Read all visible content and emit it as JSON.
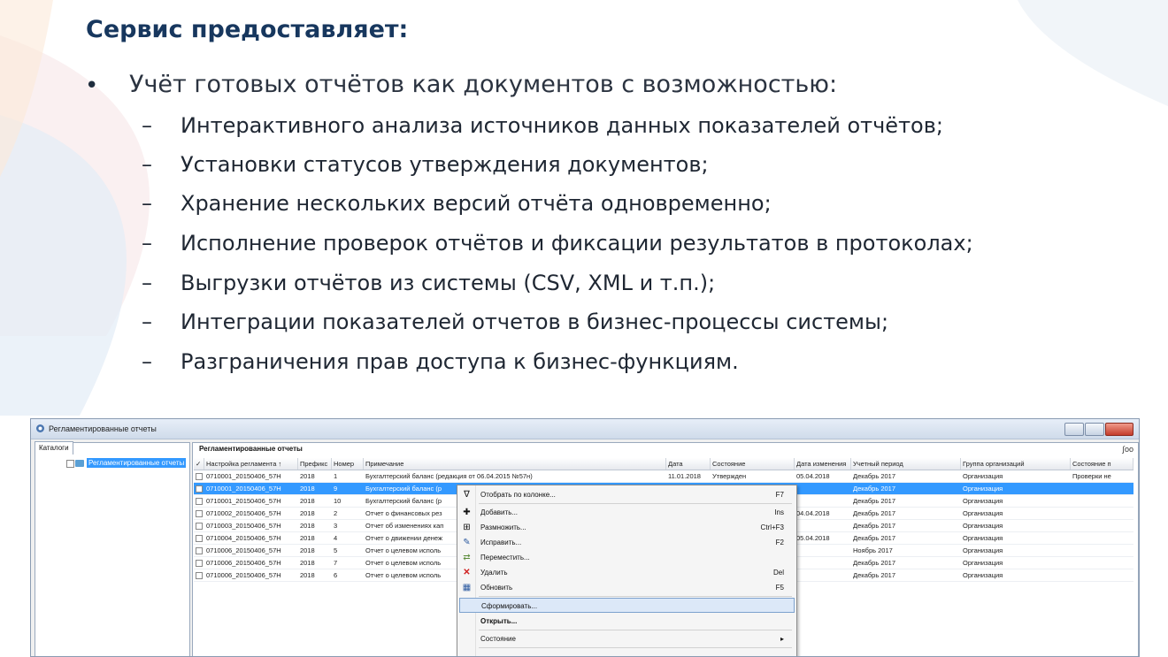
{
  "slide": {
    "title": "Сервис предоставляет:",
    "bullet": "Учёт готовых отчётов как документов с возможностью:",
    "items": [
      "Интерактивного анализа источников данных показателей отчётов;",
      "Установки статусов утверждения документов;",
      "Хранение нескольких версий отчёта одновременно;",
      "Исполнение проверок отчётов и фиксации результатов в протоколах;",
      "Выгрузки отчётов из системы (CSV, XML и т.п.);",
      "Интеграции показателей отчетов в бизнес-процессы системы;",
      "Разграничения прав доступа к бизнес-функциям."
    ],
    "dash": "–",
    "bullet_glyph": "•"
  },
  "window": {
    "title": "Регламентированные отчеты",
    "catalog_tab": "Каталоги",
    "tree_item": "Регламентированные отчеты",
    "grid_title": "Регламентированные отчеты",
    "filter_glyph": "∫oo",
    "columns": {
      "check": "✓",
      "setting": "Настройка регламента ↑",
      "prefix": "Префикс",
      "number": "Номер",
      "note": "Примечание",
      "date": "Дата",
      "state": "Состояние",
      "changed": "Дата изменения",
      "period": "Учетный период",
      "group": "Группа организаций",
      "check_state": "Состояние п"
    },
    "rows": [
      {
        "setting": "0710001_20150406_57Н",
        "prefix": "2018",
        "number": "1",
        "note": "Бухгалтерский баланс (редакция от 06.04.2015 №57н)",
        "date": "11.01.2018",
        "state": "Утвержден",
        "changed": "05.04.2018",
        "period": "Декабрь 2017",
        "group": "Организация",
        "check_state": "Проверки не"
      },
      {
        "setting": "0710001_20150406_57Н",
        "prefix": "2018",
        "number": "9",
        "note": "Бухгалтерский баланс (р",
        "date": "",
        "state": "",
        "changed": "",
        "period": "Декабрь 2017",
        "group": "Организация",
        "check_state": ""
      },
      {
        "setting": "0710001_20150406_57Н",
        "prefix": "2018",
        "number": "10",
        "note": "Бухгалтерский баланс (р",
        "date": "",
        "state": "",
        "changed": "",
        "period": "Декабрь 2017",
        "group": "Организация",
        "check_state": ""
      },
      {
        "setting": "0710002_20150406_57Н",
        "prefix": "2018",
        "number": "2",
        "note": "Отчет о финансовых рез",
        "date": "",
        "state": "",
        "changed": "04.04.2018",
        "period": "Декабрь 2017",
        "group": "Организация",
        "check_state": ""
      },
      {
        "setting": "0710003_20150406_57Н",
        "prefix": "2018",
        "number": "3",
        "note": "Отчет об изменениях кап",
        "date": "",
        "state": "",
        "changed": "",
        "period": "Декабрь 2017",
        "group": "Организация",
        "check_state": ""
      },
      {
        "setting": "0710004_20150406_57Н",
        "prefix": "2018",
        "number": "4",
        "note": "Отчет о движении денеж",
        "date": "",
        "state": "",
        "changed": "05.04.2018",
        "period": "Декабрь 2017",
        "group": "Организация",
        "check_state": ""
      },
      {
        "setting": "0710006_20150406_57Н",
        "prefix": "2018",
        "number": "5",
        "note": "Отчет о целевом исполь",
        "date": "",
        "state": "",
        "changed": "",
        "period": "Ноябрь 2017",
        "group": "Организация",
        "check_state": ""
      },
      {
        "setting": "0710006_20150406_57Н",
        "prefix": "2018",
        "number": "7",
        "note": "Отчет о целевом исполь",
        "date": "",
        "state": "",
        "changed": "",
        "period": "Декабрь 2017",
        "group": "Организация",
        "check_state": ""
      },
      {
        "setting": "0710006_20150406_57Н",
        "prefix": "2018",
        "number": "6",
        "note": "Отчет о целевом исполь",
        "date": "",
        "state": "",
        "changed": "",
        "period": "Декабрь 2017",
        "group": "Организация",
        "check_state": ""
      }
    ],
    "menu": {
      "filter_by_column": "Отобрать по колонке...",
      "filter_key": "F7",
      "add": "Добавить...",
      "add_key": "Ins",
      "duplicate": "Размножить...",
      "duplicate_key": "Ctrl+F3",
      "edit": "Исправить...",
      "edit_key": "F2",
      "move": "Переместить...",
      "delete": "Удалить",
      "delete_key": "Del",
      "refresh": "Обновить",
      "refresh_key": "F5",
      "generate": "Сформировать...",
      "open": "Открыть...",
      "state": "Состояние",
      "state_arrow": "▸"
    }
  }
}
